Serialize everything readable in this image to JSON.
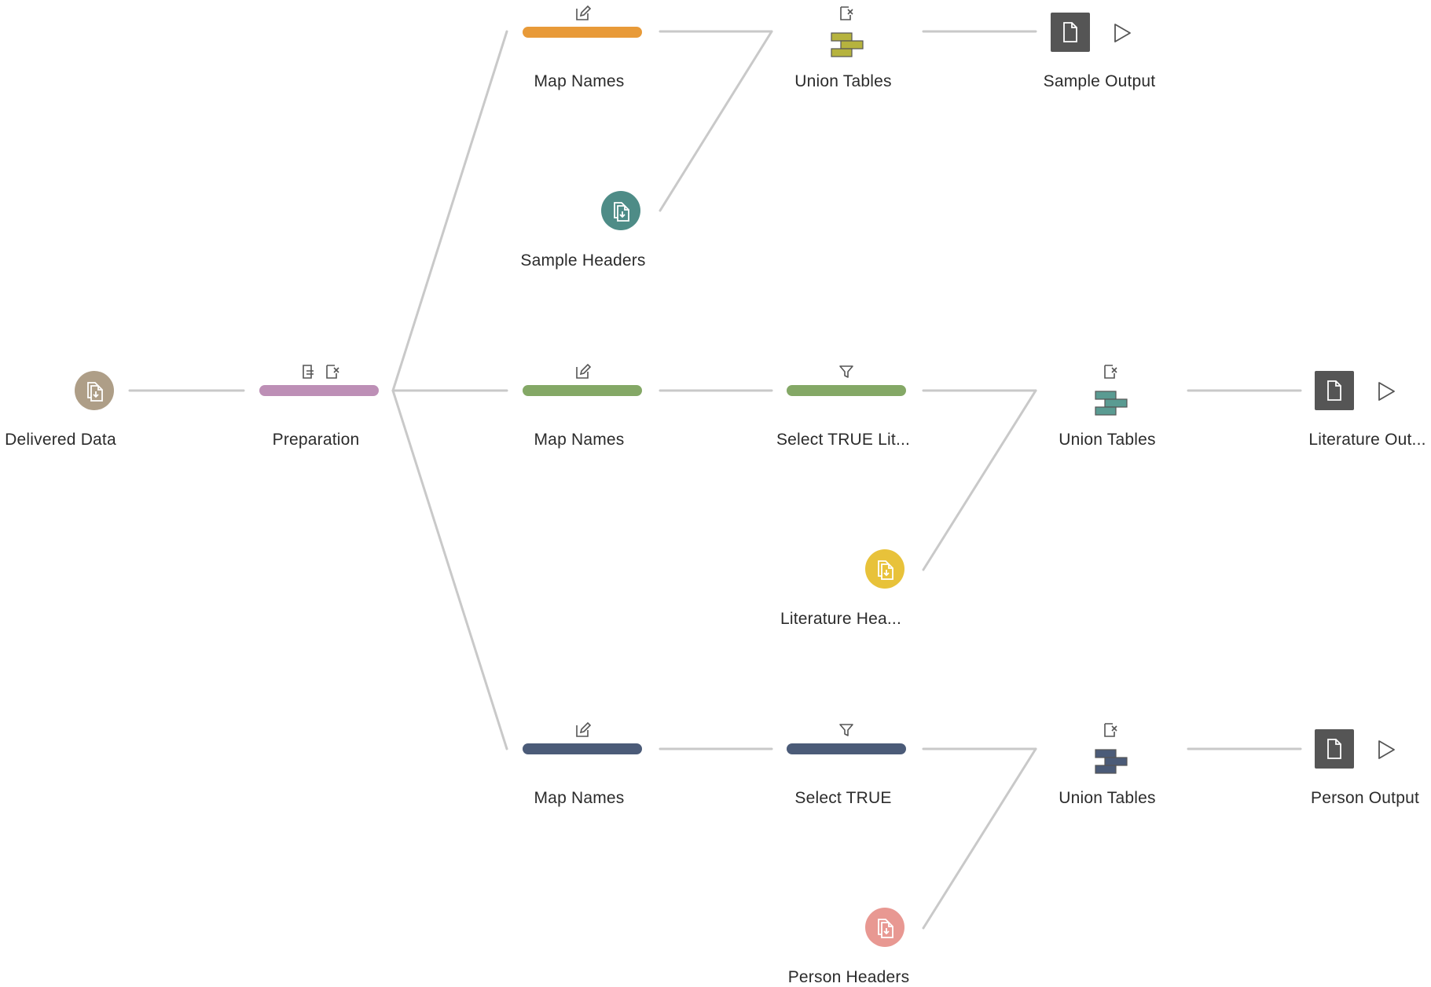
{
  "flow": {
    "colors": {
      "connector": "#c9c9c9",
      "preparation": "#bd8fb6",
      "sample": "#e89a38",
      "literature": "#84a866",
      "person": "#4b5b78",
      "delivered": "#ae9e87",
      "sample_headers": "#4e8c87",
      "literature_headers": "#e8c23a",
      "person_headers": "#e89892",
      "union_sample": "#b6b33e",
      "union_literature": "#5a9b92",
      "union_person": "#4b5b78",
      "output": "#555555"
    },
    "labels": {
      "delivered_data": "Delivered Data",
      "preparation": "Preparation",
      "map_names_sample": "Map Names",
      "sample_headers": "Sample Headers",
      "union_tables_sample": "Union Tables",
      "sample_output": "Sample Output",
      "map_names_literature": "Map Names",
      "select_true_literature": "Select TRUE Lit...",
      "literature_headers": "Literature Hea...",
      "union_tables_literature": "Union Tables",
      "literature_output": "Literature Out...",
      "map_names_person": "Map Names",
      "select_true_person": "Select TRUE",
      "person_headers": "Person Headers",
      "union_tables_person": "Union Tables",
      "person_output": "Person Output"
    },
    "icons": {
      "input": "input-file-icon",
      "edit": "edit-pencil-icon",
      "remove": "remove-field-icon",
      "calc": "calculated-field-icon",
      "filter": "filter-icon",
      "union": "union-icon",
      "output": "output-file-icon",
      "run": "run-play-icon"
    }
  }
}
